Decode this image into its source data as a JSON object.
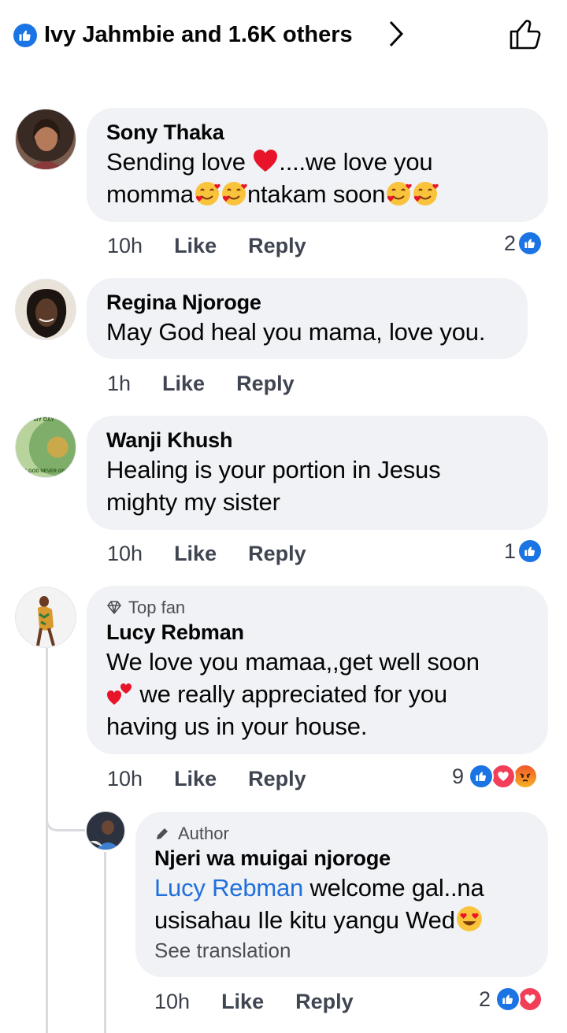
{
  "reactions_summary": {
    "text": "Ivy Jahmbie and 1.6K others",
    "chevron": "›",
    "like_icon": "thumbs-up-outline-icon"
  },
  "comments": [
    {
      "name": "Sony Thaka",
      "line1": "Sending love",
      "line1b": "....we love you",
      "line2a": "momma",
      "line2b": "ntakam soon",
      "time": "10h",
      "like": "Like",
      "reply": "Reply",
      "reaction_count": "2"
    },
    {
      "name": "Regina Njoroge",
      "text": "May God heal you mama,  love you.",
      "time": "1h",
      "like": "Like",
      "reply": "Reply"
    },
    {
      "name": "Wanji Khush",
      "text1": "Healing is your portion in Jesus",
      "text2": "mighty my sister",
      "time": "10h",
      "like": "Like",
      "reply": "Reply",
      "reaction_count": "1",
      "avatar_caption_top": "IS MY DAY",
      "avatar_caption_bottom": "OF GOD NEVER GIVES"
    },
    {
      "badge": "Top fan",
      "name": "Lucy Rebman",
      "text1": "We love you mamaa,,get well soon",
      "text2": "we really appreciated for you",
      "text3": "having us in your house.",
      "time": "10h",
      "like": "Like",
      "reply": "Reply",
      "reaction_count": "9"
    }
  ],
  "reply": {
    "badge": "Author",
    "name": "Njeri wa muigai njoroge",
    "mention": "Lucy Rebman",
    "text1": " welcome gal..na",
    "text2": "usisahau Ile kitu yangu Wed",
    "see_translation": "See translation",
    "time": "10h",
    "like": "Like",
    "reply": "Reply",
    "reaction_count": "2"
  },
  "colors": {
    "facebook_blue": "#1b74e4",
    "bubble": "#f0f2f5",
    "heart": "#f33e58",
    "mention": "#216fdb"
  }
}
